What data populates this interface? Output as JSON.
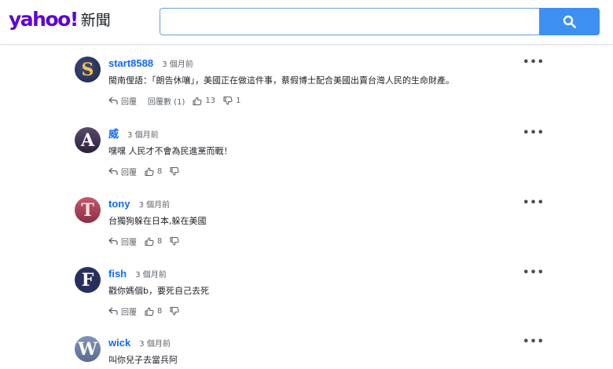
{
  "header": {
    "logo_word": "yahoo!",
    "logo_section": "新聞",
    "search_placeholder": "",
    "brand_color": "#6001d2",
    "search_button_color": "#3d90f2"
  },
  "comments": [
    {
      "username": "start8588",
      "time": "3 個月前",
      "text": "閩南俚語：「朗告休嚷」，美國正在做這件事，蔡假博士配合美國出賣台灣人民的生命財產。",
      "avatar_letter": "S",
      "avatar_color": "#2a3560",
      "reply_label": "回覆",
      "replies_label": "回覆數 (1)",
      "likes": "13",
      "dislikes": "1"
    },
    {
      "username": "威",
      "time": "3 個月前",
      "text": "嘿嘿 人民才不會為民進黨而戰！",
      "avatar_letter": "A",
      "avatar_color": "#3a2f4f",
      "reply_label": "回覆",
      "likes": "8"
    },
    {
      "username": "tony",
      "time": "3 個月前",
      "text": "台獨狗躲在日本,躲在美國",
      "avatar_letter": "T",
      "avatar_color": "#a8425a",
      "reply_label": "回覆",
      "likes": "8"
    },
    {
      "username": "fish",
      "time": "3 個月前",
      "text": "戳你媽個b，要死自己去死",
      "avatar_letter": "F",
      "avatar_color": "#27305c",
      "reply_label": "回覆",
      "likes": "8"
    },
    {
      "username": "wick",
      "time": "3 個月前",
      "text": "叫你兒子去當兵阿",
      "avatar_letter": "W",
      "avatar_color": "#6e7fa3"
    }
  ]
}
